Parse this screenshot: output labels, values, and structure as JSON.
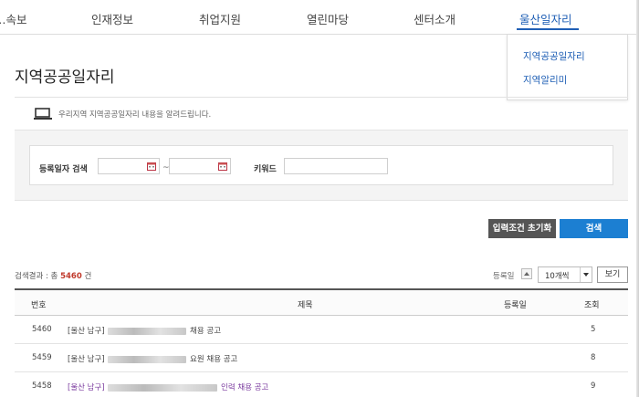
{
  "nav": {
    "items": [
      "…속보",
      "인재정보",
      "취업지원",
      "열린마당",
      "센터소개",
      "울산일자리"
    ],
    "active_index": 5
  },
  "dropdown": {
    "items": [
      "지역공공일자리",
      "지역알리미"
    ]
  },
  "page": {
    "title": "지역공공일자리",
    "info": "우리지역 지역공공일자리 내용을 알려드립니다."
  },
  "search": {
    "date_label": "등록일자 검색",
    "date_from": "",
    "date_to": "",
    "tilde": "~",
    "keyword_label": "키워드",
    "keyword": ""
  },
  "buttons": {
    "reset": "입력조건 초기화",
    "search": "검색",
    "view": "보기"
  },
  "results": {
    "count_prefix": "검색결과 : 총",
    "count": "5460",
    "count_suffix": "건",
    "sort_label": "등록일",
    "per_page": "10개씩"
  },
  "table": {
    "headers": [
      "번호",
      "제목",
      "등록일",
      "조회"
    ],
    "rows": [
      {
        "no": "5460",
        "prefix": "[울산 남구]",
        "suffix": "채용 공고",
        "date": "",
        "views": "5"
      },
      {
        "no": "5459",
        "prefix": "[울산 남구]",
        "suffix": "요원 채용 공고",
        "date": "",
        "views": "8"
      },
      {
        "no": "5458",
        "prefix": "[울산 남구]",
        "suffix": "인력 채용 공고",
        "date": "",
        "views": "9"
      }
    ]
  },
  "colors": {
    "accent": "#1f5fb5",
    "search_btn": "#1c7fd2",
    "reset_btn": "#555555",
    "count": "#c0392b"
  }
}
